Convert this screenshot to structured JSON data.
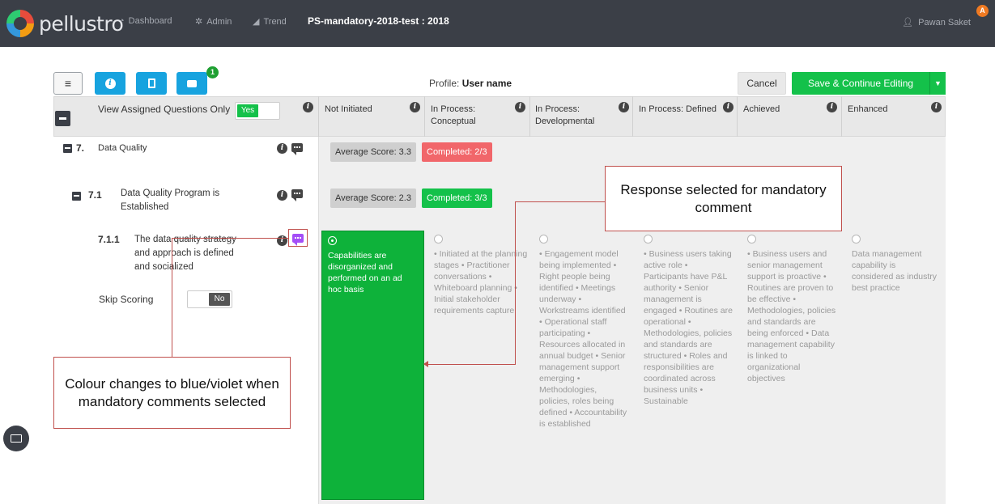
{
  "nav": {
    "brand": "pellustro",
    "items": [
      "Dashboard",
      "Admin",
      "Trend"
    ],
    "doc_title": "PS-mandatory-2018-test : 2018",
    "user_name": "Pawan Saket",
    "user_badge": "A"
  },
  "toolbar": {
    "menu_icon": "≡",
    "notification_count": "1",
    "profile_label": "Profile:",
    "profile_value": "User name",
    "cancel_label": "Cancel",
    "save_label": "Save & Continue Editing"
  },
  "header": {
    "view_assigned_label": "View Assigned Questions Only",
    "view_assigned_toggle": "Yes",
    "columns": [
      "Not Initiated",
      "In Process: Conceptual",
      "In Process: Developmental",
      "In Process: Defined",
      "Achieved",
      "Enhanced"
    ]
  },
  "tree": {
    "section_number": "7.",
    "section_title": "Data Quality",
    "section_avg": "Average Score: 3.3",
    "section_completed": "Completed: 2/3",
    "sub_number": "7.1",
    "sub_title": "Data Quality Program is Established",
    "sub_avg": "Average Score: 2.3",
    "sub_completed": "Completed: 3/3",
    "q_number": "7.1.1",
    "q_title": "The data quality strategy and approach is defined and socialized",
    "skip_label": "Skip Scoring",
    "skip_toggle": "No"
  },
  "responses": [
    "Capabilities are disorganized and performed on an ad hoc basis",
    "• Initiated at the planning stages • Practitioner conversations • Whiteboard planning • Initial stakeholder requirements capture",
    "• Engagement model being implemented • Right people being identified • Meetings underway • Workstreams identified • Operational staff participating • Resources allocated in annual budget • Senior management support emerging • Methodologies, policies, roles being defined • Accountability is established",
    "• Business users taking active role • Participants have P&L authority • Senior management is engaged • Routines are operational • Methodologies, policies and standards are structured • Roles and responsibilities are coordinated across business units • Sustainable",
    "• Business users and senior management support is proactive • Routines are proven to be effective • Methodologies, policies and standards are being enforced • Data management capability is linked to organizational objectives",
    "Data management capability is considered as industry best practice"
  ],
  "annotations": {
    "response_note": "Response selected for mandatory comment",
    "colour_note": "Colour changes to blue/violet when mandatory comments selected"
  },
  "colors": {
    "accent_green": "#14c14a",
    "accent_blue": "#17a3df",
    "mandatory_violet": "#a44ef7",
    "annotation_red": "#c0504d"
  }
}
